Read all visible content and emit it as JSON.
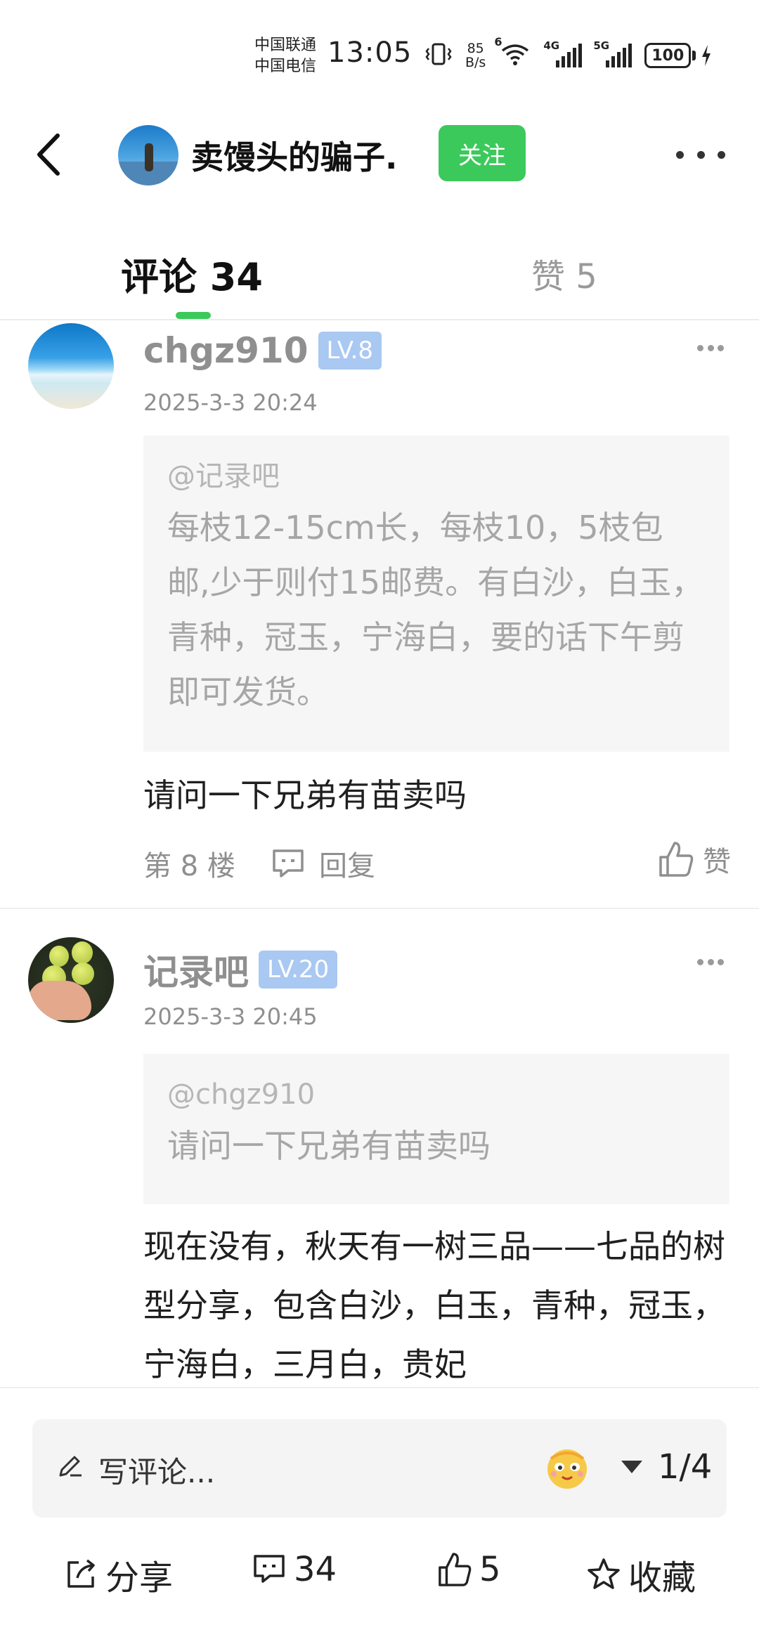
{
  "status_bar": {
    "carrier1": "中国联通",
    "carrier2": "中国电信",
    "time": "13:05",
    "net_speed_value": "85",
    "net_speed_unit": "B/s",
    "wifi_tag": "6",
    "sig1_tag": "4G",
    "sig2_tag": "5G",
    "battery": "100"
  },
  "header": {
    "author_name": "卖馒头的骗子.",
    "follow_label": "关注"
  },
  "tabs": {
    "comments_label": "评论 34",
    "likes_label": "赞 5"
  },
  "comments": [
    {
      "user": "chgz910",
      "level": "LV.8",
      "date": "2025-3-3 20:24",
      "quote_user": "@记录吧",
      "quote_text": "每枝12-15cm长，每枝10，5枝包邮,少于则付15邮费。有白沙，白玉，青种，冠玉，宁海白，要的话下午剪即可发货。",
      "body": "请问一下兄弟有苗卖吗",
      "floor": "第 8 楼",
      "reply_label": "回复",
      "like_label": "赞"
    },
    {
      "user": "记录吧",
      "level": "LV.20",
      "date": "2025-3-3 20:45",
      "quote_user": "@chgz910",
      "quote_text": "请问一下兄弟有苗卖吗",
      "body": "现在没有，秋天有一树三品——七品的树型分享，包含白沙，白玉，青种，冠玉，宁海白，三月白，贵妃"
    }
  ],
  "bottom": {
    "input_placeholder": "写评论...",
    "page_indicator": "1/4",
    "share_label": "分享",
    "comment_count": "34",
    "like_count": "5",
    "favorite_label": "收藏"
  },
  "colors": {
    "accent_green": "#3cc95b",
    "level_badge": "#a9c8f2",
    "muted_text": "#8f8f8f"
  }
}
